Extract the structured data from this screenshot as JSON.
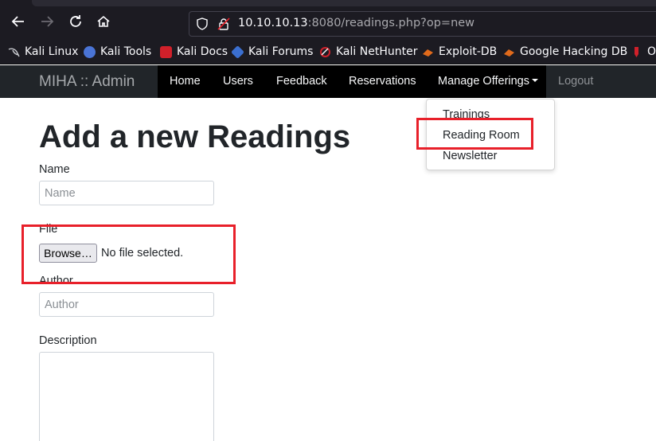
{
  "browser": {
    "url_host": "10.10.10.13",
    "url_rest": ":8080/readings.php?op=new",
    "bookmarks": [
      {
        "label": "Kali Linux",
        "icon": "kali-dragon-icon",
        "color": "#9aa0a6"
      },
      {
        "label": "Kali Tools",
        "icon": "kali-tools-icon",
        "color": "#4a74d6"
      },
      {
        "label": "Kali Docs",
        "icon": "kali-docs-icon",
        "color": "#d0202a"
      },
      {
        "label": "Kali Forums",
        "icon": "kali-forums-icon",
        "color": "#3b6fd0"
      },
      {
        "label": "Kali NetHunter",
        "icon": "nethunter-icon",
        "color": "#d0202a"
      },
      {
        "label": "Exploit-DB",
        "icon": "exploit-db-icon",
        "color": "#e06a1b"
      },
      {
        "label": "Google Hacking DB",
        "icon": "ghdb-icon",
        "color": "#e06a1b"
      },
      {
        "label": "O",
        "icon": "offsec-icon",
        "color": "#d0202a"
      }
    ]
  },
  "navbar": {
    "brand": "MIHA :: Admin",
    "links": [
      "Home",
      "Users",
      "Feedback",
      "Reservations",
      "Manage Offerings",
      "Logout"
    ]
  },
  "dropdown": {
    "items": [
      "Trainings",
      "Reading Room",
      "Newsletter"
    ]
  },
  "form": {
    "title": "Add a new Readings",
    "name_label": "Name",
    "name_placeholder": "Name",
    "file_label": "File",
    "browse_label": "Browse…",
    "file_status": "No file selected.",
    "author_label": "Author",
    "author_placeholder": "Author",
    "description_label": "Description"
  },
  "colors": {
    "highlight": "#e8202a",
    "navbar_bg": "#212529",
    "browser_bg": "#1c1b22"
  }
}
